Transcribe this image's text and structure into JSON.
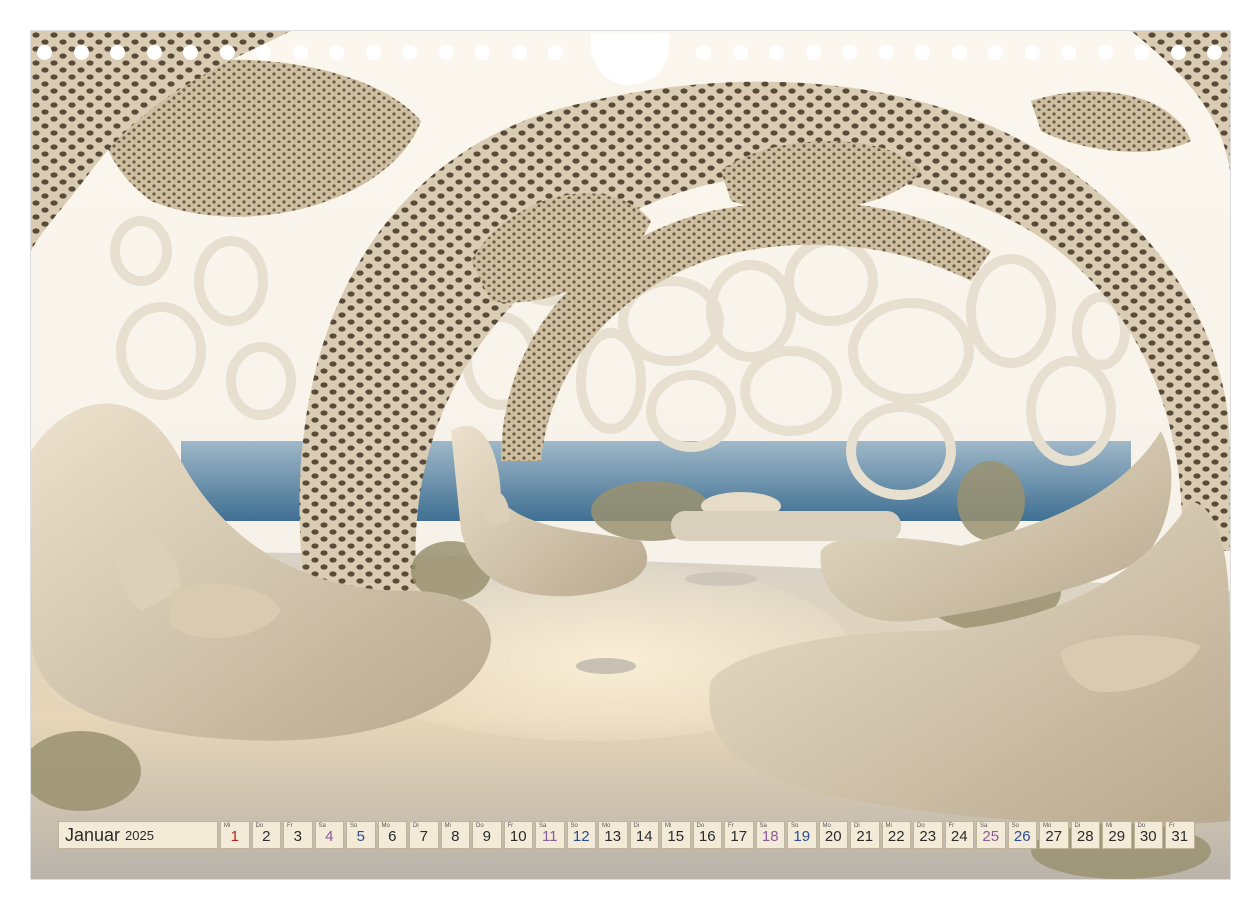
{
  "calendar": {
    "month": "Januar",
    "year": "2025",
    "days": [
      {
        "wd": "Mi",
        "d": "1",
        "kind": "hol"
      },
      {
        "wd": "Do",
        "d": "2",
        "kind": ""
      },
      {
        "wd": "Fr",
        "d": "3",
        "kind": ""
      },
      {
        "wd": "Sa",
        "d": "4",
        "kind": "sat"
      },
      {
        "wd": "So",
        "d": "5",
        "kind": "sun"
      },
      {
        "wd": "Mo",
        "d": "6",
        "kind": ""
      },
      {
        "wd": "Di",
        "d": "7",
        "kind": ""
      },
      {
        "wd": "Mi",
        "d": "8",
        "kind": ""
      },
      {
        "wd": "Do",
        "d": "9",
        "kind": ""
      },
      {
        "wd": "Fr",
        "d": "10",
        "kind": ""
      },
      {
        "wd": "Sa",
        "d": "11",
        "kind": "sat"
      },
      {
        "wd": "So",
        "d": "12",
        "kind": "sun"
      },
      {
        "wd": "Mo",
        "d": "13",
        "kind": ""
      },
      {
        "wd": "Di",
        "d": "14",
        "kind": ""
      },
      {
        "wd": "Mi",
        "d": "15",
        "kind": ""
      },
      {
        "wd": "Do",
        "d": "16",
        "kind": ""
      },
      {
        "wd": "Fr",
        "d": "17",
        "kind": ""
      },
      {
        "wd": "Sa",
        "d": "18",
        "kind": "sat"
      },
      {
        "wd": "So",
        "d": "19",
        "kind": "sun"
      },
      {
        "wd": "Mo",
        "d": "20",
        "kind": ""
      },
      {
        "wd": "Di",
        "d": "21",
        "kind": ""
      },
      {
        "wd": "Mi",
        "d": "22",
        "kind": ""
      },
      {
        "wd": "Do",
        "d": "23",
        "kind": ""
      },
      {
        "wd": "Fr",
        "d": "24",
        "kind": ""
      },
      {
        "wd": "Sa",
        "d": "25",
        "kind": "sat"
      },
      {
        "wd": "So",
        "d": "26",
        "kind": "sun"
      },
      {
        "wd": "Mo",
        "d": "27",
        "kind": ""
      },
      {
        "wd": "Di",
        "d": "28",
        "kind": ""
      },
      {
        "wd": "Mi",
        "d": "29",
        "kind": ""
      },
      {
        "wd": "Do",
        "d": "30",
        "kind": ""
      },
      {
        "wd": "Fr",
        "d": "31",
        "kind": ""
      }
    ]
  },
  "colors": {
    "cell_bg": "#f3ebd8",
    "saturday": "#8a5a9a",
    "sunday": "#2a4f8f",
    "holiday": "#b3261e"
  },
  "photo_icon": "organic-lounge-photo"
}
